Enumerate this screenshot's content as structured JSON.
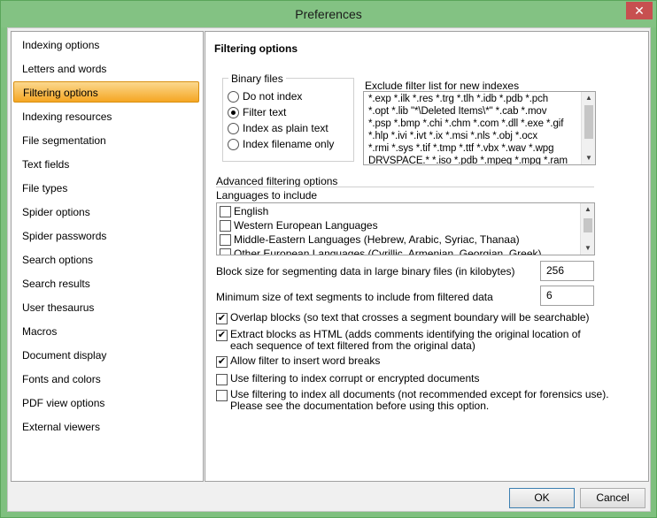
{
  "window": {
    "title": "Preferences",
    "close_glyph": "✕"
  },
  "sidebar": {
    "items": [
      {
        "label": "Indexing options"
      },
      {
        "label": "Letters and words"
      },
      {
        "label": "Filtering options",
        "active": true
      },
      {
        "label": "Indexing resources"
      },
      {
        "label": "File segmentation"
      },
      {
        "label": "Text fields"
      },
      {
        "label": "File types"
      },
      {
        "label": "Spider options"
      },
      {
        "label": "Spider passwords"
      },
      {
        "label": "Search options"
      },
      {
        "label": "Search results"
      },
      {
        "label": "User thesaurus"
      },
      {
        "label": "Macros"
      },
      {
        "label": "Document display"
      },
      {
        "label": "Fonts and colors"
      },
      {
        "label": "PDF view options"
      },
      {
        "label": "External viewers"
      }
    ]
  },
  "panel": {
    "title": "Filtering options",
    "binary_files": {
      "label": "Binary files",
      "options": [
        {
          "label": "Do not index",
          "selected": false
        },
        {
          "label": "Filter text",
          "selected": true
        },
        {
          "label": "Index as plain text",
          "selected": false
        },
        {
          "label": "Index filename only",
          "selected": false
        }
      ]
    },
    "exclude": {
      "label": "Exclude filter list for new indexes",
      "lines": [
        "*.exp *.ilk *.res *.trg *.tlh *.idb *.pdb *.pch",
        "*.opt *.lib \"*\\Deleted Items\\*\" *.cab *.mov",
        "*.psp *.bmp *.chi *.chm *.com *.dll *.exe *.gif",
        "*.hlp *.ivi *.ivt *.ix *.msi *.nls *.obj *.ocx",
        "*.rmi *.sys *.tif *.tmp *.ttf *.vbx *.wav *.wpg",
        "DRVSPACE.* *.iso *.pdb *.mpeg *.mpg *.ram"
      ]
    },
    "advanced_label": "Advanced filtering options",
    "languages": {
      "label": "Languages to include",
      "items": [
        {
          "label": "English",
          "checked": false
        },
        {
          "label": "Western European Languages",
          "checked": false
        },
        {
          "label": "Middle-Eastern Languages (Hebrew, Arabic, Syriac, Thanaa)",
          "checked": false
        },
        {
          "label": "Other European Languages (Cyrillic, Armenian, Georgian, Greek)",
          "checked": false
        }
      ]
    },
    "block_size": {
      "label": "Block size for segmenting data in large binary files (in kilobytes)",
      "value": "256"
    },
    "min_size": {
      "label": "Minimum size of text segments to include from filtered data",
      "value": "6"
    },
    "options": [
      {
        "text": "Overlap blocks (so text that crosses a segment boundary will be searchable)",
        "checked": true
      },
      {
        "text": "Extract blocks as HTML (adds comments identifying the original location of each sequence of text filtered from the original data)",
        "checked": true
      },
      {
        "text": "Allow filter to insert word breaks",
        "checked": true
      },
      {
        "text": "Use filtering to index corrupt or encrypted documents",
        "checked": false
      },
      {
        "text": "Use filtering to index all documents (not recommended except for forensics use).  Please see the documentation before using this option.",
        "checked": false
      }
    ]
  },
  "buttons": {
    "ok": "OK",
    "cancel": "Cancel"
  },
  "scroll_glyphs": {
    "up": "▲",
    "down": "▼"
  },
  "check_glyph": "✔",
  "colors": {
    "title_bar": "#83c283",
    "active_item": "#f5a623",
    "close_button": "#c75050"
  }
}
